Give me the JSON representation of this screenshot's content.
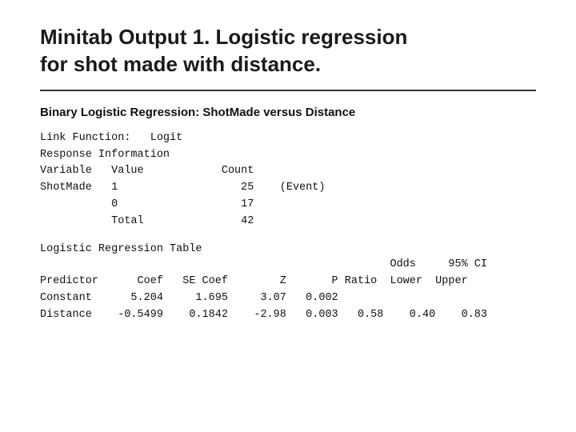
{
  "title": {
    "line1": "Minitab Output 1.  Logistic regression",
    "line2": "for shot made with distance."
  },
  "section_header": "Binary Logistic Regression: ShotMade versus Distance",
  "link_function_block": "Link Function:   Logit\nResponse Information\nVariable   Value            Count\nShotMade   1                   25    (Event)\n           0                   17\n           Total               42",
  "regression_table_label": "Logistic Regression Table",
  "regression_table_header_indent": "                                                      Odds     95% CI",
  "regression_table_col_headers": "Predictor      Coef   SE Coef        Z       P Ratio  Lower  Upper",
  "regression_table_row1": "Constant      5.204     1.695     3.07   0.002",
  "regression_table_row2": "Distance    -0.5499    0.1842    -2.98   0.003   0.58    0.40    0.83"
}
